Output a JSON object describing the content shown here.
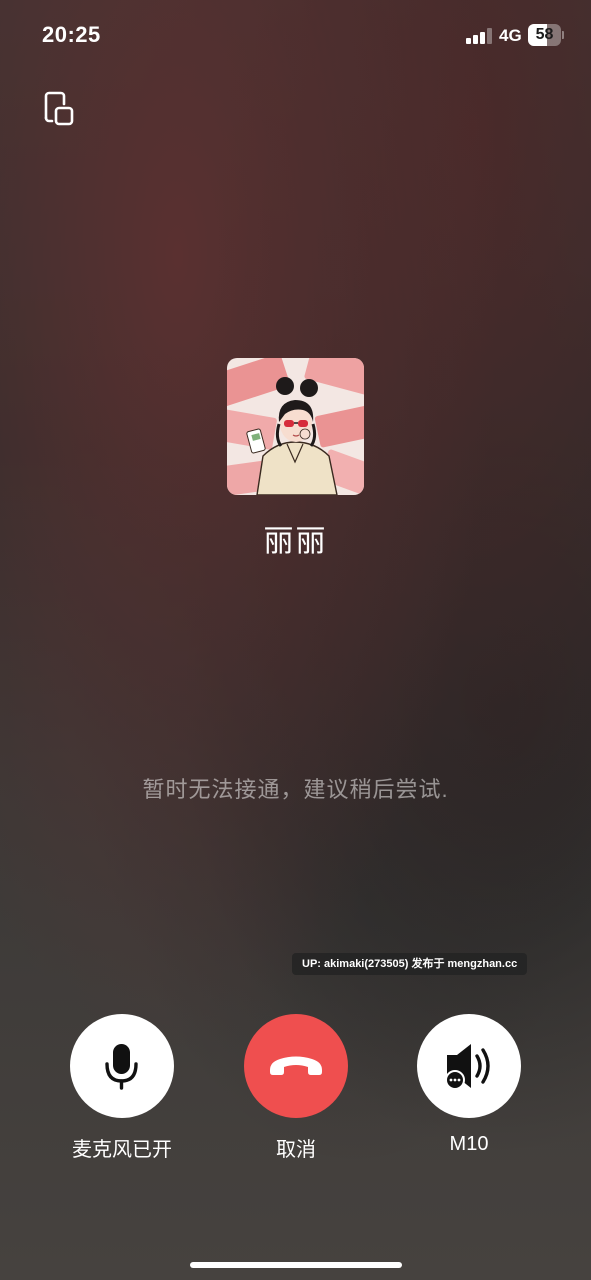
{
  "status_bar": {
    "time": "20:25",
    "network": "4G",
    "battery": "58",
    "battery_level": 0.58,
    "signal_bars": 3
  },
  "icons": {
    "minimize": "window-minimize-icon",
    "microphone": "microphone-icon",
    "hangup": "phone-hangup-icon",
    "speaker": "speaker-icon"
  },
  "contact": {
    "name": "丽丽",
    "avatar": "cartoon-girl-avatar"
  },
  "call": {
    "status_message": "暂时无法接通，建议稍后尝试."
  },
  "watermark": "UP: akimaki(273505) 发布于 mengzhan.cc",
  "controls": {
    "mic_label": "麦克风已开",
    "cancel_label": "取消",
    "speaker_label": "M10"
  },
  "colors": {
    "hangup": "#ef4f4f",
    "button_bg": "#ffffff"
  }
}
